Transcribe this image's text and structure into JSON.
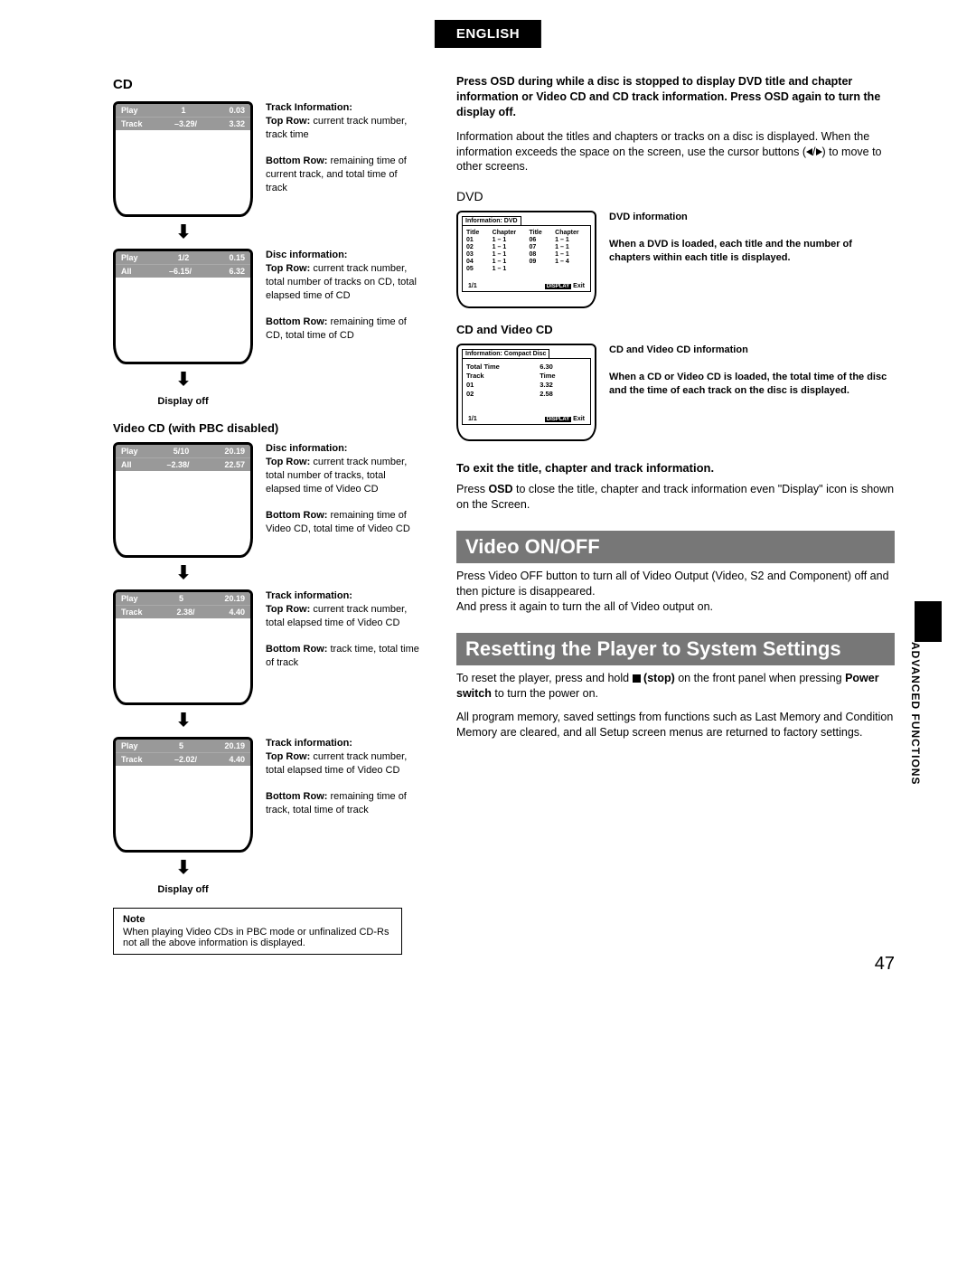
{
  "lang_badge": "ENGLISH",
  "side_tab": "ADVANCED FUNCTIONS",
  "page_number": "47",
  "left": {
    "cd_heading": "CD",
    "cd1": {
      "row1": {
        "a": "Play",
        "b": "1",
        "c": "0.03"
      },
      "row2": {
        "a": "Track",
        "b": "–3.29/",
        "c": "3.32"
      }
    },
    "cd1_desc_title": "Track Information:",
    "cd1_desc_top_lab": "Top Row:",
    "cd1_desc_top": " current track number, track time",
    "cd1_desc_bot_lab": "Bottom Row:",
    "cd1_desc_bot": " remaining time of current track, and total time of track",
    "cd2": {
      "row1": {
        "a": "Play",
        "b": "1/2",
        "c": "0.15"
      },
      "row2": {
        "a": "All",
        "b": "–6.15/",
        "c": "6.32"
      }
    },
    "cd2_desc_title": "Disc information:",
    "cd2_desc_top_lab": "Top Row:",
    "cd2_desc_top": " current track number, total number of tracks on CD, total elapsed time of CD",
    "cd2_desc_bot_lab": "Bottom Row:",
    "cd2_desc_bot": " remaining time of CD, total time of CD",
    "display_off": "Display off",
    "vcd_heading": "Video CD (with PBC disabled)",
    "vcd1": {
      "row1": {
        "a": "Play",
        "b": "5/10",
        "c": "20.19"
      },
      "row2": {
        "a": "All",
        "b": "–2.38/",
        "c": "22.57"
      }
    },
    "vcd1_desc_title": "Disc information:",
    "vcd1_desc_top_lab": "Top Row:",
    "vcd1_desc_top": " current track number, total number of tracks, total elapsed time of Video CD",
    "vcd1_desc_bot_lab": "Bottom Row:",
    "vcd1_desc_bot": " remaining time of Video CD, total time of Video CD",
    "vcd2": {
      "row1": {
        "a": "Play",
        "b": "5",
        "c": "20.19"
      },
      "row2": {
        "a": "Track",
        "b": "2.38/",
        "c": "4.40"
      }
    },
    "vcd2_desc_title": "Track information:",
    "vcd2_desc_top_lab": "Top Row:",
    "vcd2_desc_top": " current track number, total elapsed time of Video CD",
    "vcd2_desc_bot_lab": "Bottom Row:",
    "vcd2_desc_bot": " track time, total time of track",
    "vcd3": {
      "row1": {
        "a": "Play",
        "b": "5",
        "c": "20.19"
      },
      "row2": {
        "a": "Track",
        "b": "–2.02/",
        "c": "4.40"
      }
    },
    "vcd3_desc_title": "Track information:",
    "vcd3_desc_top_lab": "Top Row:",
    "vcd3_desc_top": " current track number, total elapsed time of Video CD",
    "vcd3_desc_bot_lab": "Bottom Row:",
    "vcd3_desc_bot": " remaining time of track, total time of track",
    "note_label": "Note",
    "note_text": "When playing Video CDs in PBC mode or unfinalized CD-Rs not all the above information is displayed."
  },
  "right": {
    "intro_bold": "Press OSD during while a disc is stopped to display DVD title and chapter information or Video CD and CD track information. Press OSD again to turn the display off.",
    "intro_body_a": "Information about the titles and chapters or tracks on a disc is displayed. When the information exceeds the space on the screen, use the cursor buttons (",
    "intro_body_b": ") to move to other screens.",
    "dvd_heading": "DVD",
    "dvd_tab": "Information: DVD",
    "dvd_table_hdr": {
      "a": "Title",
      "b": "Chapter",
      "c": "Title",
      "d": "Chapter"
    },
    "dvd_rows": [
      {
        "a": "01",
        "b": "1 – 1",
        "c": "06",
        "d": "1 – 1"
      },
      {
        "a": "02",
        "b": "1 – 1",
        "c": "07",
        "d": "1 – 1"
      },
      {
        "a": "03",
        "b": "1 – 1",
        "c": "08",
        "d": "1 – 1"
      },
      {
        "a": "04",
        "b": "1 – 1",
        "c": "09",
        "d": "1 – 4"
      },
      {
        "a": "05",
        "b": "1 – 1",
        "c": "",
        "d": ""
      }
    ],
    "dvd_footer_page": "1/1",
    "dvd_footer_btn": "DISPLAY",
    "dvd_footer_exit": "Exit",
    "dvd_desc_title": "DVD information",
    "dvd_desc_body": "When a DVD is loaded, each title and the number of chapters within each title is displayed.",
    "cdvcd_heading": "CD and Video CD",
    "cdvcd_tab": "Information: Compact Disc",
    "cdvcd_total_label": "Total Time",
    "cdvcd_total_value": "6.30",
    "cdvcd_hdr": {
      "a": "Track",
      "b": "Time"
    },
    "cdvcd_rows": [
      {
        "a": "01",
        "b": "3.32"
      },
      {
        "a": "02",
        "b": "2.58"
      }
    ],
    "cdvcd_desc_title": "CD and Video CD information",
    "cdvcd_desc_body": "When a CD or Video CD is loaded, the total time of the disc and the time of each track on the disc  is displayed.",
    "exit_heading": "To exit the title, chapter and track information.",
    "exit_body_a": "Press ",
    "exit_body_osd": "OSD",
    "exit_body_b": " to close the title, chapter and track information even \"Display\" icon is shown on the Screen.",
    "video_onoff_heading": "Video ON/OFF",
    "video_onoff_body": "Press Video OFF button to turn all of Video Output (Video, S2 and Component) off and then picture is disappeared.\nAnd press it again to turn the all of Video output on.",
    "reset_heading": "Resetting the Player to System Settings",
    "reset_body_a": "To reset the player, press and hold ",
    "reset_stop": " (stop)",
    "reset_body_b": " on the front panel when pressing ",
    "reset_power": "Power switch",
    "reset_body_c": " to turn the power on.",
    "reset_body2": "All program memory, saved settings from functions such as Last Memory and Condition Memory are cleared, and all Setup screen menus are returned to factory settings."
  }
}
